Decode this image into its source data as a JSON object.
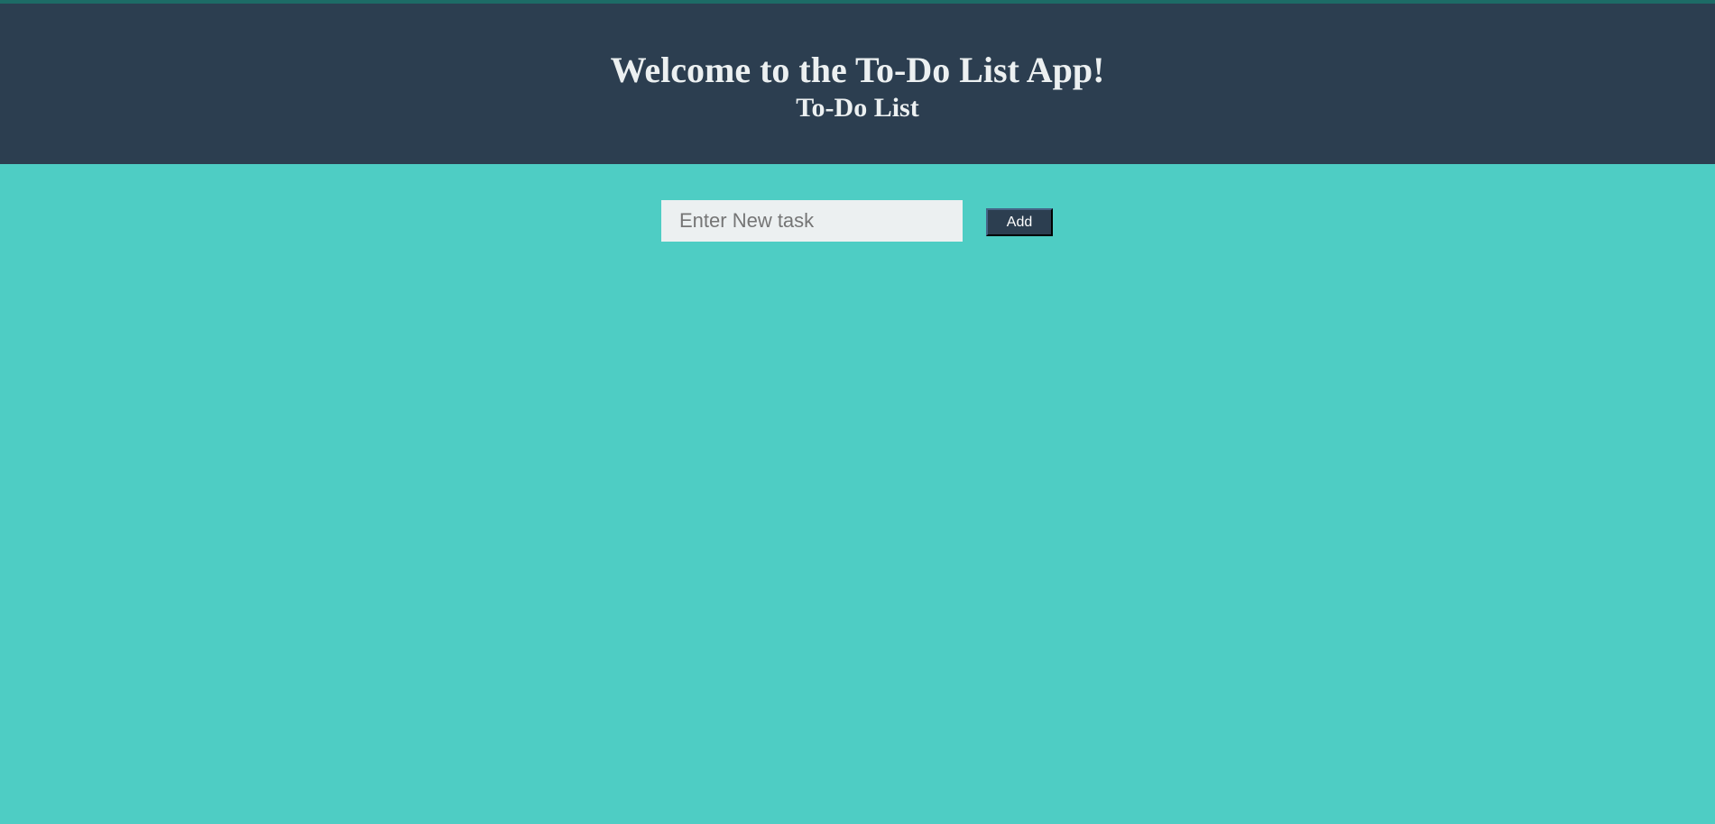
{
  "header": {
    "title": "Welcome to the To-Do List App!",
    "subtitle": "To-Do List"
  },
  "task_form": {
    "input_value": "",
    "input_placeholder": "Enter New task",
    "add_label": "Add"
  },
  "tasks": [],
  "colors": {
    "page_background": "#4ecdc4",
    "header_background": "#2c3e50",
    "header_text": "#ecf0f1",
    "input_background": "#ecf0f1",
    "button_background": "#2c3e50",
    "button_text": "#ffffff"
  }
}
